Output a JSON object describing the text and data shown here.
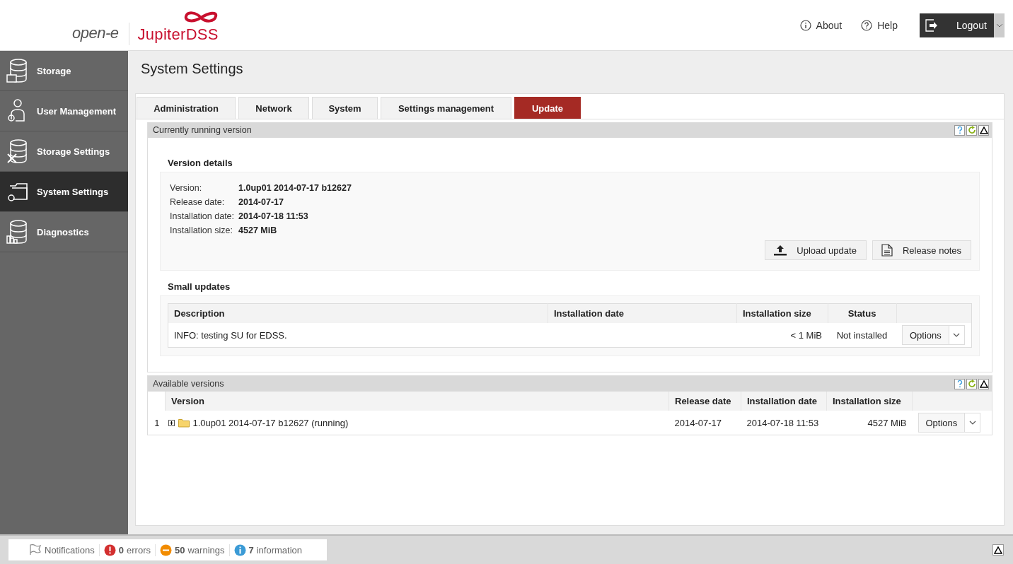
{
  "header": {
    "brand": "open-e",
    "product_name": "JupiterDSS",
    "links": [
      {
        "label": "About",
        "kind": "info"
      },
      {
        "label": "Help",
        "kind": "help"
      }
    ],
    "logout": "Logout"
  },
  "sidebar": {
    "items": [
      {
        "label": "Storage",
        "kind": "storage",
        "selected": false
      },
      {
        "label": "User Management",
        "kind": "user",
        "selected": false
      },
      {
        "label": "Storage Settings",
        "kind": "storage-settings",
        "selected": false
      },
      {
        "label": "System Settings",
        "kind": "system",
        "selected": true
      },
      {
        "label": "Diagnostics",
        "kind": "diagnostics",
        "selected": false
      }
    ]
  },
  "page_title": "System Settings",
  "tabs": [
    {
      "label": "Administration",
      "selected": false
    },
    {
      "label": "Network",
      "selected": false
    },
    {
      "label": "System",
      "selected": false
    },
    {
      "label": "Settings management",
      "selected": false
    },
    {
      "label": "Update",
      "selected": true
    }
  ],
  "current_version": {
    "title": "Currently running version",
    "details_title": "Version details",
    "details": [
      {
        "label": "Version:",
        "value": "1.0up01 2014-07-17 b12627"
      },
      {
        "label": "Release date:",
        "value": "2014-07-17"
      },
      {
        "label": "Installation date:",
        "value": "2014-07-18 11:53"
      },
      {
        "label": "Installation size:",
        "value": "4527 MiB"
      }
    ],
    "buttons": [
      {
        "label": "Upload update",
        "kind": "upload"
      },
      {
        "label": "Release notes",
        "kind": "notes"
      }
    ],
    "small_updates": {
      "title": "Small updates",
      "columns": [
        "Description",
        "Installation date",
        "Installation size",
        "Status"
      ],
      "rows": [
        {
          "description": "INFO: testing SU for EDSS.",
          "size": "< 1 MiB",
          "status": "Not installed",
          "action": "Options"
        }
      ]
    }
  },
  "available_versions": {
    "title": "Available versions",
    "columns": [
      "Version",
      "Release date",
      "Installation date",
      "Installation size"
    ],
    "rows": [
      {
        "index": "1",
        "expanded": false,
        "version": "1.0up01 2014-07-17 b12627 (running)",
        "release_date": "2014-07-17",
        "installation_date": "2014-07-18 11:53",
        "size": "4527 MiB",
        "action": "Options"
      }
    ]
  },
  "status_bar": {
    "label": "Notifications",
    "counts": [
      {
        "kind": "error",
        "count": "0",
        "label": "errors",
        "color": "#d32f2f"
      },
      {
        "kind": "warning",
        "count": "50",
        "label": "warnings",
        "color": "#f28c00"
      },
      {
        "kind": "info",
        "count": "7",
        "label": "information",
        "color": "#3b9bd6"
      }
    ]
  }
}
